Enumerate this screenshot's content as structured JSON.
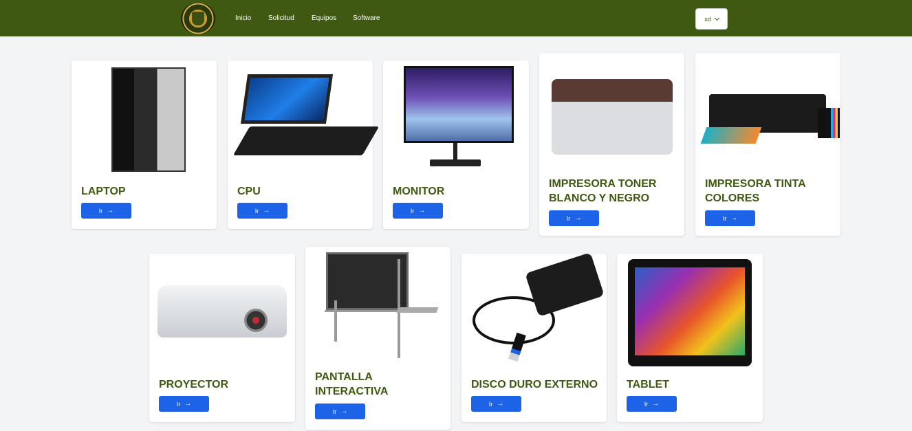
{
  "nav": {
    "logo_alt": "logo",
    "links": [
      "Inicio",
      "Solicitud",
      "Equipos",
      "Software"
    ],
    "user_select": "xd"
  },
  "cards": [
    {
      "title": "LAPTOP",
      "button": "Ir",
      "image": "pc-tower"
    },
    {
      "title": "CPU",
      "button": "Ir",
      "image": "laptop"
    },
    {
      "title": "MONITOR",
      "button": "Ir",
      "image": "monitor"
    },
    {
      "title": "IMPRESORA TONER BLANCO Y NEGRO",
      "button": "Ir",
      "image": "laser-printer"
    },
    {
      "title": "IMPRESORA TINTA COLORES",
      "button": "Ir",
      "image": "ink-printer"
    },
    {
      "title": "PROYECTOR",
      "button": "Ir",
      "image": "projector"
    },
    {
      "title": "PANTALLA INTERACTIVA",
      "button": "Ir",
      "image": "interactive-board"
    },
    {
      "title": "DISCO DURO EXTERNO",
      "button": "Ir",
      "image": "external-hdd"
    },
    {
      "title": "TABLET",
      "button": "Ir",
      "image": "tablet"
    }
  ],
  "colors": {
    "navbar": "#3f5a10",
    "title": "#3f5a10",
    "button": "#1d63e8",
    "background": "#f3f4f6"
  },
  "icons": {
    "button_icon": "arrow-right-icon",
    "select_icon": "chevron-down-icon"
  }
}
